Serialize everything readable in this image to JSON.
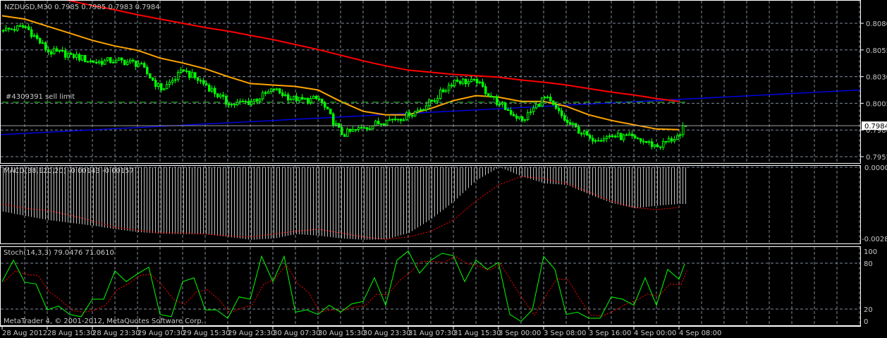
{
  "window": {
    "symbol_header": "NZDUSD,M30  0.7985 0.7985 0.7983 0.7984",
    "copyright": "MetaTrader 4, © 2001-2012, MetaQuotes Software Corp."
  },
  "colors": {
    "background": "#000000",
    "candle": "#00ff00",
    "ma_fast": "#ffa500",
    "ma_slow": "#ff0000",
    "trendline": "#0000ff",
    "sell_limit": "#32cd32",
    "macd_hist": "#c0c0c0",
    "macd_signal": "#ff0000",
    "stoch_main": "#00ff00",
    "stoch_signal": "#ff0000",
    "grid": "#7f8a99",
    "bid_line": "#a0a0a0"
  },
  "main_panel": {
    "order_label": "#4309391 sell limit",
    "current_price_label": "0.7984",
    "price_axis_labels": [
      "0.8080",
      "0.8055",
      "0.8030",
      "0.8005",
      "0.7980",
      "0.7955"
    ]
  },
  "macd_panel": {
    "label": "MACD(38,120,20) -0.00143 -0.00157",
    "axis_labels": [
      "0.00006",
      "-0.00289"
    ]
  },
  "stoch_panel": {
    "label": "Stoch(14,3,3) 79.0476 71.0610",
    "axis_labels": [
      "100",
      "80",
      "20",
      "0"
    ]
  },
  "time_axis": {
    "labels": [
      "28 Aug 2012",
      "28 Aug 15:30",
      "28 Aug 23:30",
      "29 Aug 07:30",
      "29 Aug 15:30",
      "29 Aug 23:30",
      "30 Aug 07:30",
      "30 Aug 15:30",
      "30 Aug 23:30",
      "31 Aug 07:30",
      "31 Aug 15:30",
      "3 Sep 00:00",
      "3 Sep 08:00",
      "3 Sep 16:00",
      "4 Sep 00:00",
      "4 Sep 08:00"
    ]
  },
  "chart_data": {
    "type": "line",
    "title": "NZDUSD,M30",
    "bars_per_sample": 8,
    "price_axis": [
      0.7955,
      0.808
    ],
    "close_samples": [
      0.80733,
      0.80767,
      0.80534,
      0.80507,
      0.80434,
      0.80454,
      0.80421,
      0.80175,
      0.80354,
      0.80221,
      0.80035,
      0.80068,
      0.80175,
      0.80075,
      0.80088,
      0.79756,
      0.79822,
      0.79889,
      0.79936,
      0.80068,
      0.80268,
      0.80241,
      0.80042,
      0.79889,
      0.80108,
      0.79869,
      0.79723,
      0.79743,
      0.79723,
      0.79643,
      0.79756
    ],
    "last_close": 0.7984,
    "ma_fast_samples": [
      0.8087,
      0.8084,
      0.80773,
      0.80707,
      0.8064,
      0.80587,
      0.80547,
      0.80474,
      0.80428,
      0.80374,
      0.80301,
      0.80235,
      0.80221,
      0.80208,
      0.80175,
      0.80068,
      0.79975,
      0.79942,
      0.79942,
      0.80002,
      0.80075,
      0.80122,
      0.80108,
      0.80068,
      0.80068,
      0.80022,
      0.79942,
      0.79889,
      0.79849,
      0.79809,
      0.79803
    ],
    "ma_slow_samples": [
      0.81133,
      0.81093,
      0.81053,
      0.81013,
      0.80966,
      0.80926,
      0.8088,
      0.8084,
      0.808,
      0.8076,
      0.80727,
      0.80687,
      0.80647,
      0.80601,
      0.80554,
      0.80501,
      0.80448,
      0.80401,
      0.80361,
      0.80341,
      0.80321,
      0.80308,
      0.80295,
      0.80268,
      0.80248,
      0.80222,
      0.80188,
      0.80155,
      0.80128,
      0.80095,
      0.80068
    ],
    "trendline": [
      0.79756,
      0.80175
    ],
    "sell_limit_price": 0.8006,
    "current_price": 0.7984,
    "macd": {
      "range": [
        -0.00289,
        6e-05
      ],
      "hist_samples": [
        -0.00173,
        -0.0019,
        -0.00206,
        -0.00217,
        -0.00228,
        -0.00242,
        -0.00253,
        -0.00259,
        -0.00261,
        -0.00261,
        -0.00272,
        -0.00283,
        -0.00278,
        -0.00261,
        -0.00267,
        -0.00278,
        -0.00283,
        -0.00281,
        -0.00256,
        -0.00201,
        -0.00132,
        -0.0005,
        0.0,
        -0.00036,
        -0.00063,
        -0.00069,
        -0.00107,
        -0.0014,
        -0.0016,
        -0.0015,
        -0.00143
      ],
      "signal_samples": [
        -0.00143,
        -0.0016,
        -0.00168,
        -0.00187,
        -0.00209,
        -0.00234,
        -0.00245,
        -0.00256,
        -0.00256,
        -0.00261,
        -0.00267,
        -0.00272,
        -0.00261,
        -0.0025,
        -0.00242,
        -0.00256,
        -0.00272,
        -0.00281,
        -0.00272,
        -0.0025,
        -0.00206,
        -0.00132,
        -0.00069,
        -0.00036,
        -0.00044,
        -0.00063,
        -0.00096,
        -0.00132,
        -0.00157,
        -0.00165,
        -0.00157
      ]
    },
    "stoch": {
      "range": [
        0,
        100
      ],
      "levels": [
        20,
        80
      ],
      "bars_per_sample": 4,
      "k_samples": [
        56,
        84,
        55,
        53,
        19,
        24,
        13,
        10,
        33,
        33,
        70,
        56,
        66,
        75,
        13,
        10,
        56,
        61,
        19,
        19,
        8,
        36,
        33,
        89,
        56,
        89,
        16,
        19,
        13,
        25,
        16,
        27,
        30,
        61,
        25,
        84,
        96,
        67,
        84,
        93,
        90,
        56,
        84,
        72,
        81,
        13,
        4,
        19,
        89,
        72,
        13,
        16,
        8,
        8,
        36,
        33,
        25,
        61,
        25,
        72,
        59,
        79.0476
      ]
    }
  }
}
